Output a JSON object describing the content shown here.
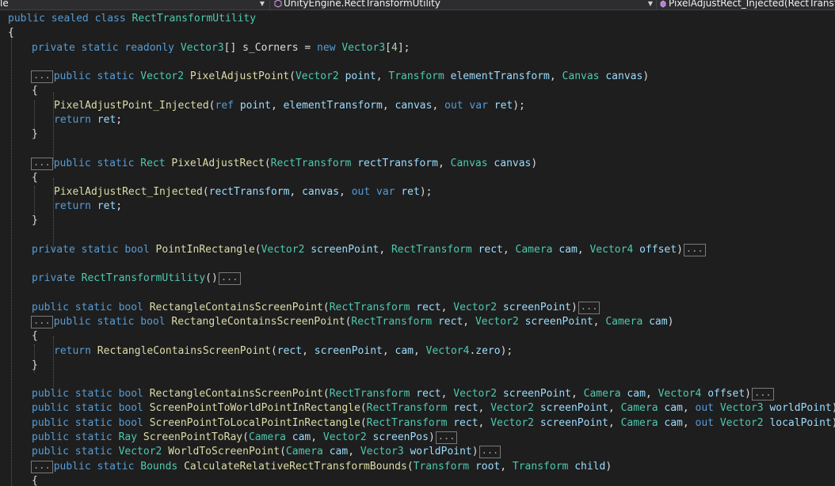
{
  "nav": {
    "left_fragment": "le",
    "type_dropdown": "UnityEngine.RectTransformUtility",
    "member_dropdown": "PixelAdjustRect_Injected(RectTransfo"
  },
  "code": {
    "collapsed_label": "...",
    "lines": [
      [
        [
          "kw",
          "public sealed class "
        ],
        [
          "ty",
          "RectTransformUtility"
        ]
      ],
      [
        [
          "pl",
          "{"
        ]
      ],
      [
        [
          "kw",
          "private static readonly "
        ],
        [
          "ty",
          "Vector3"
        ],
        [
          "pl",
          "[] s_Corners = "
        ],
        [
          "kw",
          "new "
        ],
        [
          "ty",
          "Vector3"
        ],
        [
          "pl",
          "["
        ],
        [
          "num",
          "4"
        ],
        [
          "pl",
          "];"
        ]
      ],
      [],
      [
        [
          "c",
          ""
        ],
        [
          "kw",
          "public static "
        ],
        [
          "ty",
          "Vector2 "
        ],
        [
          "fn",
          "PixelAdjustPoint"
        ],
        [
          "pl",
          "("
        ],
        [
          "ty",
          "Vector2 "
        ],
        [
          "id",
          "point"
        ],
        [
          "pl",
          ", "
        ],
        [
          "ty",
          "Transform "
        ],
        [
          "id",
          "elementTransform"
        ],
        [
          "pl",
          ", "
        ],
        [
          "ty",
          "Canvas "
        ],
        [
          "id",
          "canvas"
        ],
        [
          "pl",
          ")"
        ]
      ],
      [
        [
          "pl",
          "{"
        ]
      ],
      [
        [
          "fn",
          "PixelAdjustPoint_Injected"
        ],
        [
          "pl",
          "("
        ],
        [
          "kw",
          "ref "
        ],
        [
          "id",
          "point"
        ],
        [
          "pl",
          ", "
        ],
        [
          "id",
          "elementTransform"
        ],
        [
          "pl",
          ", "
        ],
        [
          "id",
          "canvas"
        ],
        [
          "pl",
          ", "
        ],
        [
          "kw",
          "out var "
        ],
        [
          "id",
          "ret"
        ],
        [
          "pl",
          ");"
        ]
      ],
      [
        [
          "kw",
          "return "
        ],
        [
          "id",
          "ret"
        ],
        [
          "pl",
          ";"
        ]
      ],
      [
        [
          "pl",
          "}"
        ]
      ],
      [],
      [
        [
          "c",
          ""
        ],
        [
          "kw",
          "public static "
        ],
        [
          "ty",
          "Rect "
        ],
        [
          "fn",
          "PixelAdjustRect"
        ],
        [
          "pl",
          "("
        ],
        [
          "ty",
          "RectTransform "
        ],
        [
          "id",
          "rectTransform"
        ],
        [
          "pl",
          ", "
        ],
        [
          "ty",
          "Canvas "
        ],
        [
          "id",
          "canvas"
        ],
        [
          "pl",
          ")"
        ]
      ],
      [
        [
          "pl",
          "{"
        ]
      ],
      [
        [
          "fn",
          "PixelAdjustRect_Injected"
        ],
        [
          "pl",
          "("
        ],
        [
          "id",
          "rectTransform"
        ],
        [
          "pl",
          ", "
        ],
        [
          "id",
          "canvas"
        ],
        [
          "pl",
          ", "
        ],
        [
          "kw",
          "out var "
        ],
        [
          "id",
          "ret"
        ],
        [
          "pl",
          ");"
        ]
      ],
      [
        [
          "kw",
          "return "
        ],
        [
          "id",
          "ret"
        ],
        [
          "pl",
          ";"
        ]
      ],
      [
        [
          "pl",
          "}"
        ]
      ],
      [],
      [
        [
          "kw",
          "private static bool "
        ],
        [
          "fn",
          "PointInRectangle"
        ],
        [
          "pl",
          "("
        ],
        [
          "ty",
          "Vector2 "
        ],
        [
          "id",
          "screenPoint"
        ],
        [
          "pl",
          ", "
        ],
        [
          "ty",
          "RectTransform "
        ],
        [
          "id",
          "rect"
        ],
        [
          "pl",
          ", "
        ],
        [
          "ty",
          "Camera "
        ],
        [
          "id",
          "cam"
        ],
        [
          "pl",
          ", "
        ],
        [
          "ty",
          "Vector4 "
        ],
        [
          "id",
          "offset"
        ],
        [
          "pl",
          ")"
        ],
        [
          "c",
          ""
        ]
      ],
      [],
      [
        [
          "kw",
          "private "
        ],
        [
          "ty",
          "RectTransformUtility"
        ],
        [
          "pl",
          "()"
        ],
        [
          "c",
          ""
        ]
      ],
      [],
      [
        [
          "kw",
          "public static bool "
        ],
        [
          "fn",
          "RectangleContainsScreenPoint"
        ],
        [
          "pl",
          "("
        ],
        [
          "ty",
          "RectTransform "
        ],
        [
          "id",
          "rect"
        ],
        [
          "pl",
          ", "
        ],
        [
          "ty",
          "Vector2 "
        ],
        [
          "id",
          "screenPoint"
        ],
        [
          "pl",
          ")"
        ],
        [
          "c",
          ""
        ]
      ],
      [
        [
          "c",
          ""
        ],
        [
          "kw",
          "public static bool "
        ],
        [
          "fn",
          "RectangleContainsScreenPoint"
        ],
        [
          "pl",
          "("
        ],
        [
          "ty",
          "RectTransform "
        ],
        [
          "id",
          "rect"
        ],
        [
          "pl",
          ", "
        ],
        [
          "ty",
          "Vector2 "
        ],
        [
          "id",
          "screenPoint"
        ],
        [
          "pl",
          ", "
        ],
        [
          "ty",
          "Camera "
        ],
        [
          "id",
          "cam"
        ],
        [
          "pl",
          ")"
        ]
      ],
      [
        [
          "pl",
          "{"
        ]
      ],
      [
        [
          "kw",
          "return "
        ],
        [
          "fn",
          "RectangleContainsScreenPoint"
        ],
        [
          "pl",
          "("
        ],
        [
          "id",
          "rect"
        ],
        [
          "pl",
          ", "
        ],
        [
          "id",
          "screenPoint"
        ],
        [
          "pl",
          ", "
        ],
        [
          "id",
          "cam"
        ],
        [
          "pl",
          ", "
        ],
        [
          "ty",
          "Vector4"
        ],
        [
          "pl",
          "."
        ],
        [
          "id",
          "zero"
        ],
        [
          "pl",
          ");"
        ]
      ],
      [
        [
          "pl",
          "}"
        ]
      ],
      [],
      [
        [
          "kw",
          "public static bool "
        ],
        [
          "fn",
          "RectangleContainsScreenPoint"
        ],
        [
          "pl",
          "("
        ],
        [
          "ty",
          "RectTransform "
        ],
        [
          "id",
          "rect"
        ],
        [
          "pl",
          ", "
        ],
        [
          "ty",
          "Vector2 "
        ],
        [
          "id",
          "screenPoint"
        ],
        [
          "pl",
          ", "
        ],
        [
          "ty",
          "Camera "
        ],
        [
          "id",
          "cam"
        ],
        [
          "pl",
          ", "
        ],
        [
          "ty",
          "Vector4 "
        ],
        [
          "id",
          "offset"
        ],
        [
          "pl",
          ")"
        ],
        [
          "c",
          ""
        ]
      ],
      [
        [
          "kw",
          "public static bool "
        ],
        [
          "fn",
          "ScreenPointToWorldPointInRectangle"
        ],
        [
          "pl",
          "("
        ],
        [
          "ty",
          "RectTransform "
        ],
        [
          "id",
          "rect"
        ],
        [
          "pl",
          ", "
        ],
        [
          "ty",
          "Vector2 "
        ],
        [
          "id",
          "screenPoint"
        ],
        [
          "pl",
          ", "
        ],
        [
          "ty",
          "Camera "
        ],
        [
          "id",
          "cam"
        ],
        [
          "pl",
          ", "
        ],
        [
          "kw",
          "out "
        ],
        [
          "ty",
          "Vector3 "
        ],
        [
          "id",
          "worldPoint"
        ],
        [
          "pl",
          ")"
        ],
        [
          "c",
          ""
        ]
      ],
      [
        [
          "kw",
          "public static bool "
        ],
        [
          "fn",
          "ScreenPointToLocalPointInRectangle"
        ],
        [
          "pl",
          "("
        ],
        [
          "ty",
          "RectTransform "
        ],
        [
          "id",
          "rect"
        ],
        [
          "pl",
          ", "
        ],
        [
          "ty",
          "Vector2 "
        ],
        [
          "id",
          "screenPoint"
        ],
        [
          "pl",
          ", "
        ],
        [
          "ty",
          "Camera "
        ],
        [
          "id",
          "cam"
        ],
        [
          "pl",
          ", "
        ],
        [
          "kw",
          "out "
        ],
        [
          "ty",
          "Vector2 "
        ],
        [
          "id",
          "localPoint"
        ],
        [
          "pl",
          ")"
        ],
        [
          "c",
          ""
        ]
      ],
      [
        [
          "kw",
          "public static "
        ],
        [
          "ty",
          "Ray "
        ],
        [
          "fn",
          "ScreenPointToRay"
        ],
        [
          "pl",
          "("
        ],
        [
          "ty",
          "Camera "
        ],
        [
          "id",
          "cam"
        ],
        [
          "pl",
          ", "
        ],
        [
          "ty",
          "Vector2 "
        ],
        [
          "id",
          "screenPos"
        ],
        [
          "pl",
          ")"
        ],
        [
          "c",
          ""
        ]
      ],
      [
        [
          "kw",
          "public static "
        ],
        [
          "ty",
          "Vector2 "
        ],
        [
          "fn",
          "WorldToScreenPoint"
        ],
        [
          "pl",
          "("
        ],
        [
          "ty",
          "Camera "
        ],
        [
          "id",
          "cam"
        ],
        [
          "pl",
          ", "
        ],
        [
          "ty",
          "Vector3 "
        ],
        [
          "id",
          "worldPoint"
        ],
        [
          "pl",
          ")"
        ],
        [
          "c",
          ""
        ]
      ],
      [
        [
          "c",
          ""
        ],
        [
          "kw",
          "public static "
        ],
        [
          "ty",
          "Bounds "
        ],
        [
          "fn",
          "CalculateRelativeRectTransformBounds"
        ],
        [
          "pl",
          "("
        ],
        [
          "ty",
          "Transform "
        ],
        [
          "id",
          "root"
        ],
        [
          "pl",
          ", "
        ],
        [
          "ty",
          "Transform "
        ],
        [
          "id",
          "child"
        ],
        [
          "pl",
          ")"
        ]
      ],
      [
        [
          "pl",
          "{"
        ]
      ]
    ]
  }
}
